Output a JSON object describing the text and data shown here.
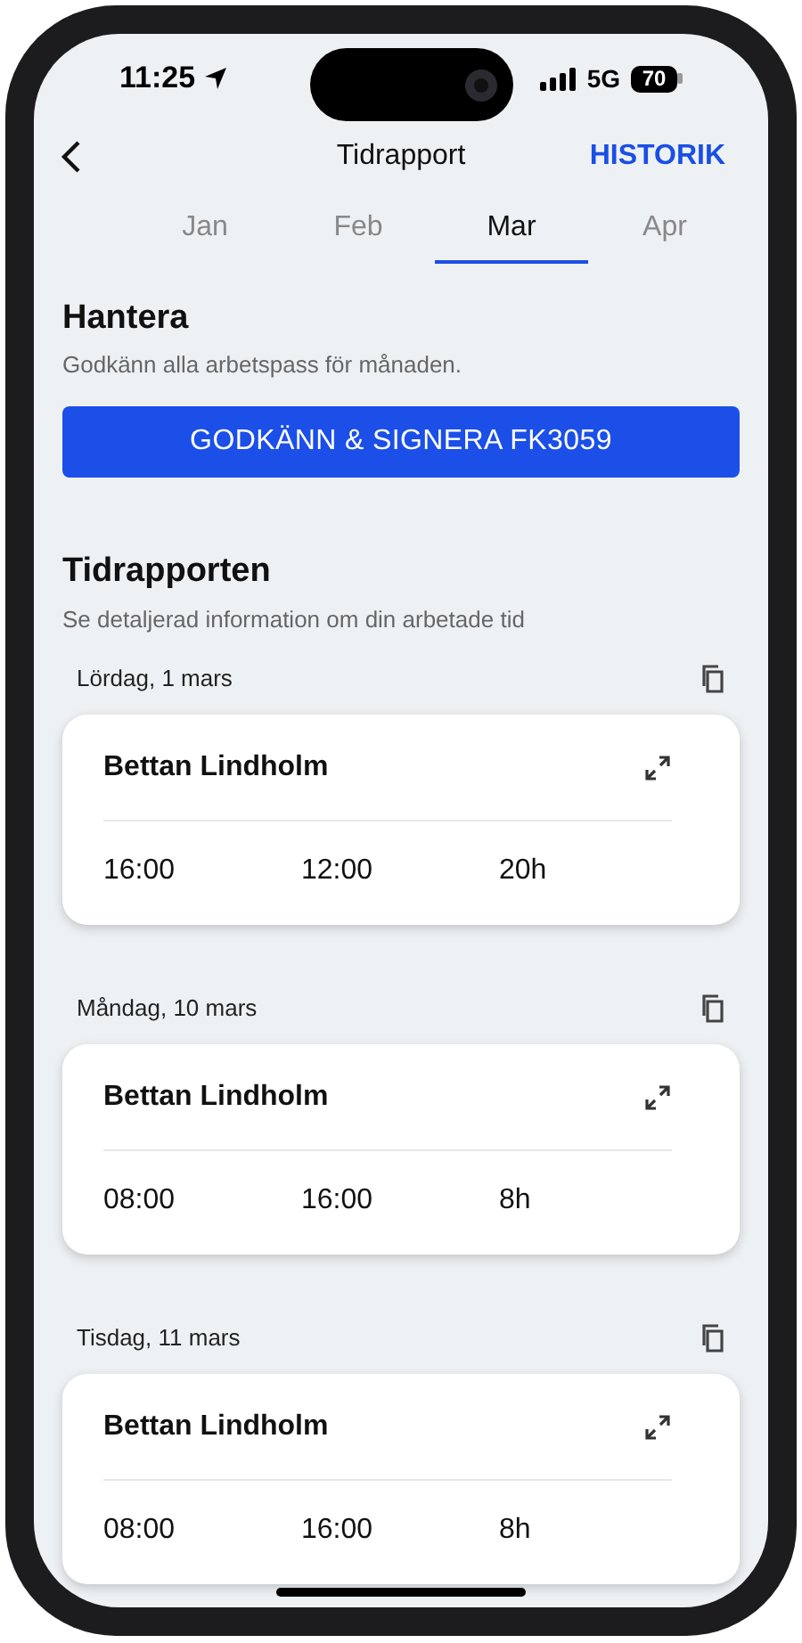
{
  "status_bar": {
    "time": "11:25",
    "network": "5G",
    "battery": "70"
  },
  "header": {
    "title": "Tidrapport",
    "action": "HISTORIK"
  },
  "months": [
    {
      "label": "Jan",
      "selected": false
    },
    {
      "label": "Feb",
      "selected": false
    },
    {
      "label": "Mar",
      "selected": true
    },
    {
      "label": "Apr",
      "selected": false
    }
  ],
  "manage": {
    "title": "Hantera",
    "subtitle": "Godkänn alla arbetspass för månaden.",
    "button": "GODKÄNN & SIGNERA FK3059"
  },
  "report": {
    "title": "Tidrapporten",
    "subtitle": "Se detaljerad information om din arbetade tid",
    "days": [
      {
        "date": "Lördag, 1 mars",
        "name": "Bettan Lindholm",
        "start": "16:00",
        "end": "12:00",
        "total": "20h"
      },
      {
        "date": "Måndag, 10 mars",
        "name": "Bettan Lindholm",
        "start": "08:00",
        "end": "16:00",
        "total": "8h"
      },
      {
        "date": "Tisdag, 11 mars",
        "name": "Bettan Lindholm",
        "start": "08:00",
        "end": "16:00",
        "total": "8h"
      }
    ]
  }
}
